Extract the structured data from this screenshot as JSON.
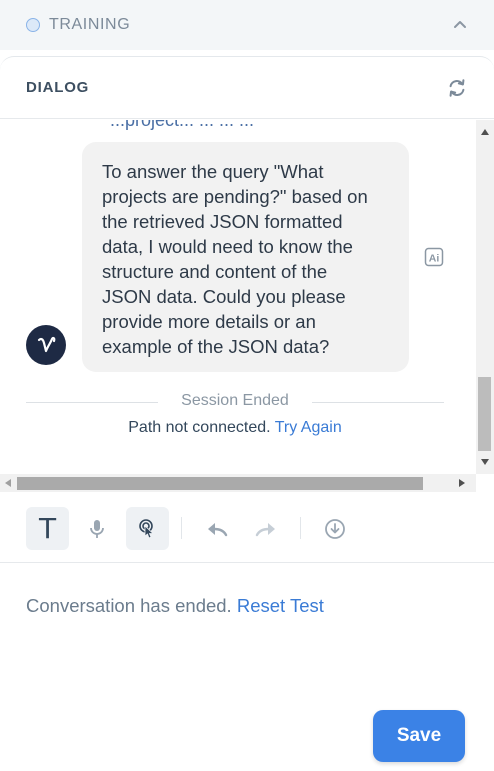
{
  "training": {
    "label": "TRAINING"
  },
  "dialog": {
    "title": "DIALOG"
  },
  "chat": {
    "clipped_text": "...project... ... ... ...",
    "avatar_letter": "V",
    "bubble_lines": [
      "To answer the query \"What",
      "projects are pending?\" based on",
      "the retrieved JSON formatted",
      "data, I would need to know the",
      "structure and content of the",
      "JSON data. Could you please",
      "provide more details or an",
      "example of the JSON data?"
    ],
    "ai_badge": "Ai",
    "session_ended": "Session Ended",
    "path_not_connected": "Path not connected.",
    "try_again": "Try Again"
  },
  "toolbar": {
    "text_tool": "T"
  },
  "footer": {
    "conversation_ended": "Conversation has ended.",
    "reset_test": "Reset Test",
    "save_label": "Save"
  },
  "colors": {
    "accent": "#3a7bd5",
    "save_button": "#3b82e6",
    "avatar_bg": "#1e2a44",
    "bubble_bg": "#f2f2f2"
  },
  "icons": [
    "status-dot-icon",
    "chevron-up-icon",
    "refresh-icon",
    "ai-icon",
    "text-icon",
    "microphone-icon",
    "touch-icon",
    "undo-icon",
    "redo-icon",
    "download-icon"
  ]
}
